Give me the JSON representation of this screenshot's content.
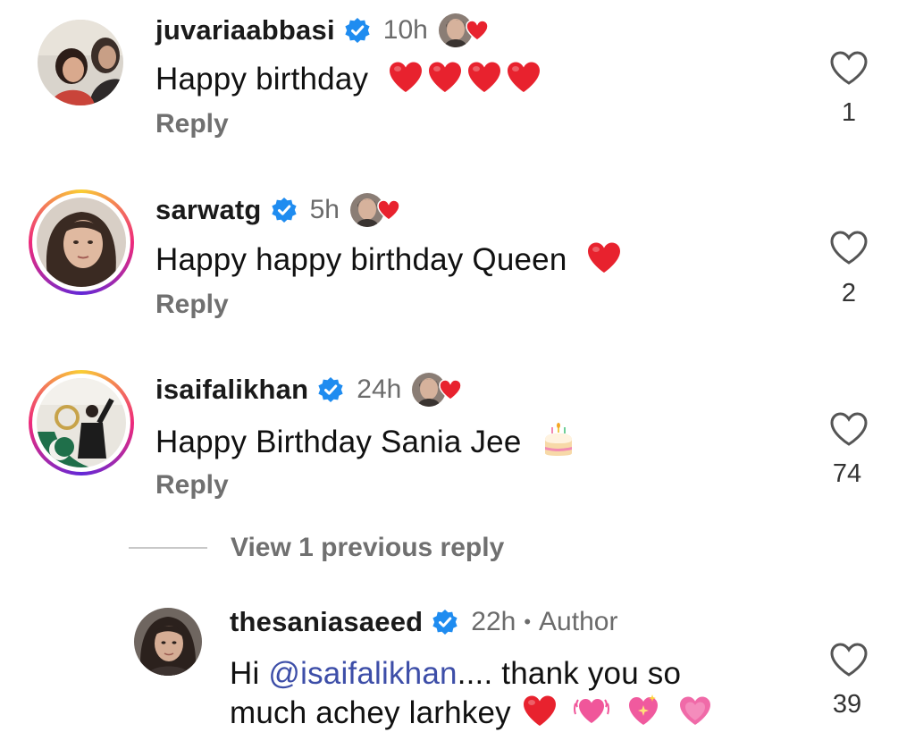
{
  "comments": [
    {
      "username": "juvariaabbasi",
      "time": "10h",
      "text": "Happy birthday",
      "reply_label": "Reply",
      "likes": "1"
    },
    {
      "username": "sarwatg",
      "time": "5h",
      "text": "Happy happy birthday Queen",
      "reply_label": "Reply",
      "likes": "2"
    },
    {
      "username": "isaifalikhan",
      "time": "24h",
      "text": "Happy Birthday Sania Jee",
      "reply_label": "Reply",
      "likes": "74"
    }
  ],
  "view_replies": "View 1 previous reply",
  "reply_comment": {
    "username": "thesaniasaeed",
    "time": "22h",
    "separator": "•",
    "author_label": "Author",
    "text_prefix": "Hi ",
    "mention": "@isaifalikhan",
    "text_line1_rest": ".... thank you so",
    "text_line2": "much achey larhkey",
    "likes": "39"
  },
  "colors": {
    "verified": "#1f8cf0",
    "heart_red": "#e8222e",
    "mention": "#3d4ea8",
    "secondary_text": "#707070"
  },
  "icons": [
    "verified-badge-icon",
    "heart-outline-icon",
    "red-heart-emoji",
    "birthday-cake-emoji",
    "beating-heart-emoji",
    "sparkling-heart-emoji",
    "pink-heart-emoji"
  ]
}
